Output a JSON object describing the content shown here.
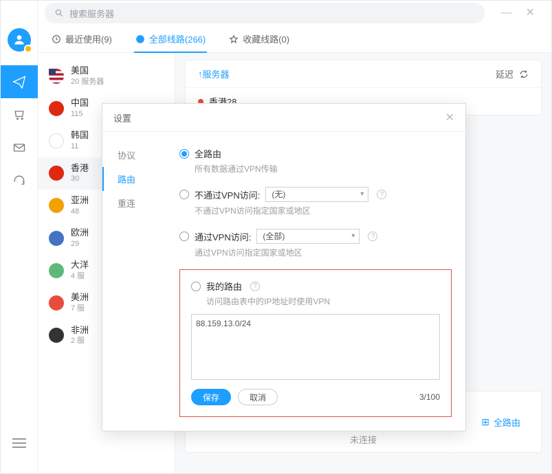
{
  "search": {
    "placeholder": "搜索服务器"
  },
  "tabs": {
    "recent": "最近使用(9)",
    "all": "全部线路(266)",
    "fav": "收藏线路(0)"
  },
  "countries": [
    {
      "name": "美国",
      "sub": "20 服务器",
      "flag": "flag-us"
    },
    {
      "name": "中国",
      "sub": "115",
      "flag": "flag-cn"
    },
    {
      "name": "韩国",
      "sub": "11",
      "flag": "flag-kr"
    },
    {
      "name": "香港",
      "sub": "30",
      "flag": "flag-hk",
      "selected": true
    },
    {
      "name": "亚洲",
      "sub": "48",
      "flag": "flag-as"
    },
    {
      "name": "欧洲",
      "sub": "29",
      "flag": "flag-eu"
    },
    {
      "name": "大洋",
      "sub": "4 服",
      "flag": "flag-oa"
    },
    {
      "name": "美洲",
      "sub": "7 服",
      "flag": "flag-am"
    },
    {
      "name": "非洲",
      "sub": "2 服",
      "flag": "flag-af"
    }
  ],
  "server_table": {
    "col_server": "服务器",
    "col_latency": "延迟",
    "rows": [
      {
        "name": "香港28"
      }
    ]
  },
  "status": {
    "speed": "-- ↑",
    "route_label": "全路由",
    "state": "未连接"
  },
  "modal": {
    "title": "设置",
    "side": {
      "protocol": "协议",
      "route": "路由",
      "reconnect": "重连"
    },
    "opts": {
      "full": {
        "label": "全路由",
        "desc": "所有数据通过VPN传输"
      },
      "bypass": {
        "label": "不通过VPN访问:",
        "select": "(无)",
        "desc": "不通过VPN访问指定国家或地区"
      },
      "via": {
        "label": "通过VPN访问:",
        "select": "(全部)",
        "desc": "通过VPN访问指定国家或地区"
      },
      "my": {
        "label": "我的路由",
        "desc": "访问路由表中的IP地址时使用VPN"
      }
    },
    "ip_value": "88.159.13.0/24",
    "save": "保存",
    "cancel": "取消",
    "counter": "3/100"
  }
}
